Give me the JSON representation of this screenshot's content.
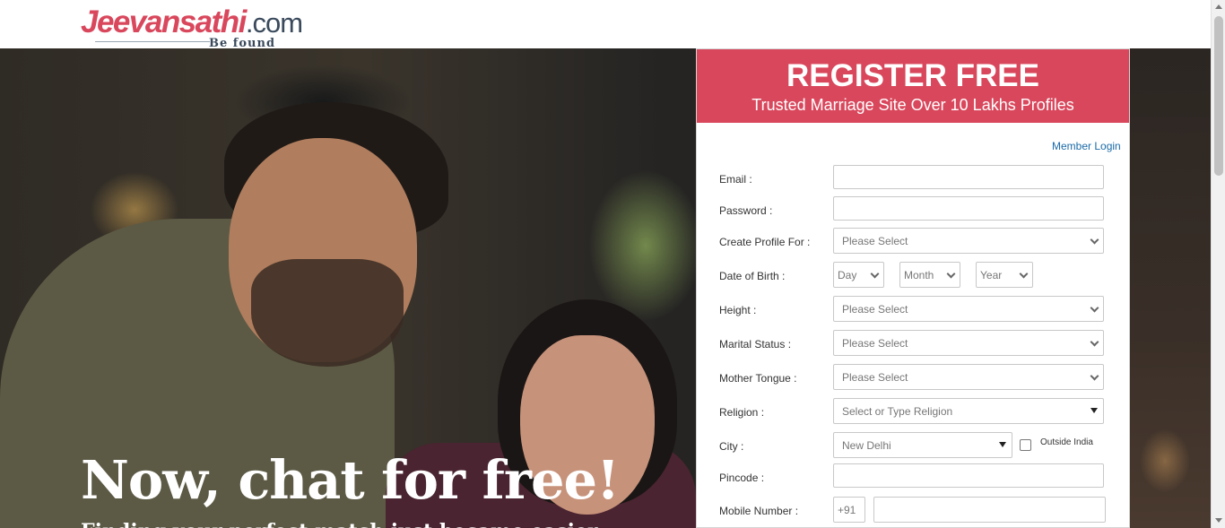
{
  "logo": {
    "brand": "Jeevansathi",
    "domain": ".com",
    "tagline": "Be found"
  },
  "hero": {
    "headline": "Now, chat for free!",
    "subline": "Finding your perfect match just became easier"
  },
  "register": {
    "title": "REGISTER FREE",
    "subtitle": "Trusted Marriage Site Over 10 Lakhs Profiles",
    "member_login": "Member Login",
    "labels": {
      "email": "Email :",
      "password": "Password :",
      "create_profile_for": "Create Profile For :",
      "date_of_birth": "Date of Birth :",
      "height": "Height :",
      "marital_status": "Marital Status :",
      "mother_tongue": "Mother Tongue :",
      "religion": "Religion :",
      "city": "City :",
      "pincode": "Pincode :",
      "mobile_number": "Mobile Number :"
    },
    "values": {
      "email": "",
      "password": "",
      "create_profile_for": "Please Select",
      "dob_day": "Day",
      "dob_month": "Month",
      "dob_year": "Year",
      "height": "Please Select",
      "marital_status": "Please Select",
      "mother_tongue": "Please Select",
      "religion": "Select or Type Religion",
      "city": "New Delhi",
      "pincode": "",
      "country_code": "+91",
      "mobile_number": ""
    },
    "outside_india_label": "Outside India",
    "outside_india_checked": false
  },
  "colors": {
    "brand": "#d9475c",
    "link": "#1a6aa8"
  },
  "icons": [
    "chevron-down-icon",
    "dropdown-triangle-icon",
    "checkbox-icon"
  ]
}
